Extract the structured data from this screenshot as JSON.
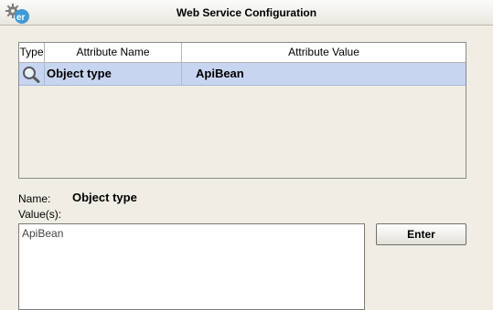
{
  "window": {
    "title": "Web Service Configuration",
    "icon": "web-service-gear-icon"
  },
  "table": {
    "columns": [
      "Type",
      "Attribute Name",
      "Attribute Value"
    ],
    "rows": [
      {
        "type_icon": "magnifier-icon",
        "name": "Object type",
        "value": "ApiBean",
        "selected": true
      }
    ]
  },
  "detail": {
    "name_label": "Name:",
    "name_value": "Object type",
    "values_label": "Value(s):",
    "values_text": "ApiBean",
    "enter_label": "Enter"
  },
  "colors": {
    "selected_row": "#c8d5f0",
    "background": "#f0ede4"
  }
}
